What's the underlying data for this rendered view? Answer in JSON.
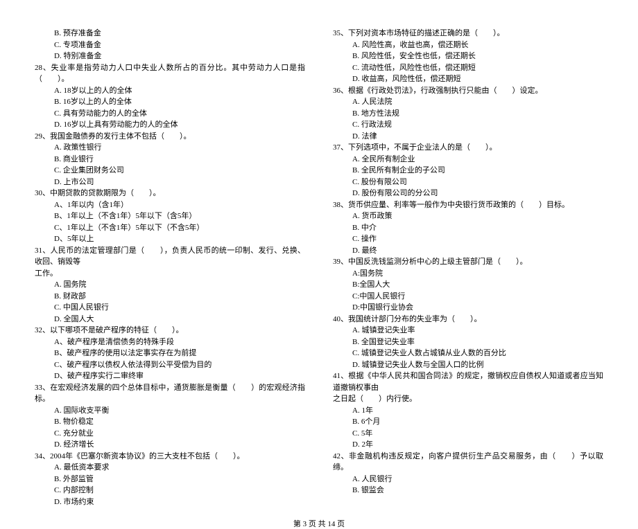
{
  "left": {
    "pre_options": [
      "B. 预存准备金",
      "C. 专项准备金",
      "D. 特别准备金"
    ],
    "questions": [
      {
        "num": "28",
        "text": "、失业率是指劳动力人口中失业人数所占的百分比。其中劳动力人口是指（　　）。",
        "options": [
          "A. 18岁以上的人的全体",
          "B. 16岁以上的人的全体",
          "C. 具有劳动能力的人的全体",
          "D. 16岁以上具有劳动能力的人的全体"
        ]
      },
      {
        "num": "29",
        "text": "、我国金融债券的发行主体不包括（　　）。",
        "options": [
          "A. 政策性银行",
          "B. 商业银行",
          "C. 企业集团财务公司",
          "D. 上市公司"
        ]
      },
      {
        "num": "30",
        "text": "、中期贷款的贷款期限为（　　）。",
        "options": [
          "A、1年以内（含1年）",
          "B、1年以上（不含1年）5年以下（含5年）",
          "C、1年以上（不含1年）5年以下（不含5年）",
          "D、5年以上"
        ]
      },
      {
        "num": "31",
        "text": "、人民币的法定管理部门是（　　），负责人民币的统一印制、发行、兑换、收回、销毁等",
        "continuation": "工作。",
        "options": [
          "A. 国务院",
          "B. 财政部",
          "C. 中国人民银行",
          "D. 全国人大"
        ]
      },
      {
        "num": "32",
        "text": "、以下哪项不是破产程序的特征（　　）。",
        "options": [
          "A、破产程序是清偿债务的特殊手段",
          "B、破产程序的使用以法定事实存在为前提",
          "C、破产程序以债权人依法得到公平受偿为目的",
          "D、破产程序实行二审终审"
        ]
      },
      {
        "num": "33",
        "text": "、在宏观经济发展的四个总体目标中，通货膨胀是衡量（　　）的宏观经济指标。",
        "options": [
          "A. 国际收支平衡",
          "B. 物价稳定",
          "C. 充分就业",
          "D. 经济增长"
        ]
      },
      {
        "num": "34",
        "text": "、2004年《巴塞尔新资本协议》的三大支柱不包括（　　）。",
        "options": [
          "A. 最低资本要求",
          "B. 外部监管",
          "C. 内部控制",
          "D. 市场约束"
        ]
      }
    ]
  },
  "right": {
    "questions": [
      {
        "num": "35",
        "text": "、下列对资本市场特征的描述正确的是（　　）。",
        "options": [
          "A. 风险性高，收益也高，偿还期长",
          "B. 风险性低，安全性也低，偿还期长",
          "C. 流动性低，风险性也低，偿还期短",
          "D. 收益高，风险性低，偿还期短"
        ]
      },
      {
        "num": "36",
        "text": "、根据《行政处罚法》，行政强制执行只能由（　　）设定。",
        "options": [
          "A. 人民法院",
          "B. 地方性法规",
          "C. 行政法规",
          "D. 法律"
        ]
      },
      {
        "num": "37",
        "text": "、下列选项中，不属于企业法人的是（　　）。",
        "options": [
          "A. 全民所有制企业",
          "B. 全民所有制企业的子公司",
          "C. 股份有限公司",
          "D. 股份有限公司的分公司"
        ]
      },
      {
        "num": "38",
        "text": "、货币供应量、利率等一般作为中央银行货币政策的（　　）目标。",
        "options": [
          "A. 货币政策",
          "B. 中介",
          "C. 操作",
          "D. 最终"
        ]
      },
      {
        "num": "39",
        "text": "、中国反洗钱监测分析中心的上级主管部门是（　　）。",
        "options": [
          "A:国务院",
          "B:全国人大",
          "C:中国人民银行",
          "D:中国银行业协会"
        ]
      },
      {
        "num": "40",
        "text": "、我国统计部门分布的失业率为（　　）。",
        "options": [
          "A. 城镇登记失业率",
          "B. 全国登记失业率",
          "C. 城镇登记失业人数占城镇从业人数的百分比",
          "D. 城镇登记失业人数与全国人口的比例"
        ]
      },
      {
        "num": "41",
        "text": "、根据《中华人民共和国合同法》的规定，撤销权应自债权人知道或者应当知道撤销权事由",
        "continuation": "之日起（　　）内行使。",
        "options": [
          "A. 1年",
          "B. 6个月",
          "C. 5年",
          "D. 2年"
        ]
      },
      {
        "num": "42",
        "text": "、非金融机构违反规定，向客户提供衍生产品交易服务，由（　　）予以取缔。",
        "options": [
          "A. 人民银行",
          "B. 银监会"
        ]
      }
    ]
  },
  "footer": "第 3 页 共 14 页"
}
